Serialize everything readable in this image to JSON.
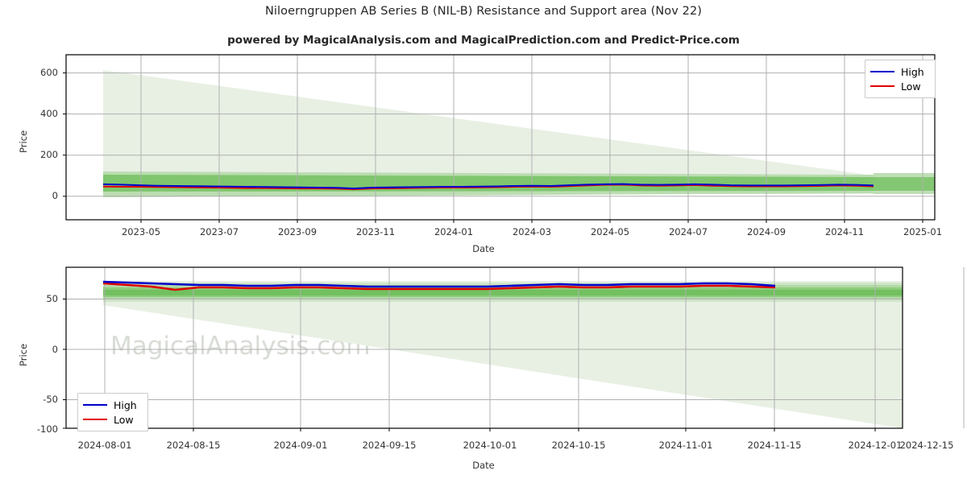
{
  "header": {
    "title": "Niloerngruppen AB Series B (NIL-B) Resistance and Support area (Nov 22)",
    "subtitle": "powered by MagicalAnalysis.com and MagicalPrediction.com and Predict-Price.com"
  },
  "watermarks": {
    "analysis": "MagicalAnalysis.com",
    "prediction": "MagicalPrediction.com"
  },
  "colors": {
    "high": "#0000cd",
    "low": "#e00000",
    "band_outer": "#e8f0e4",
    "band_mid": "#b8dbae",
    "band_inner": "#79c367",
    "grid": "#b0b0b0",
    "axis": "#000000",
    "watermark": "#d8dcd6"
  },
  "chart_data": [
    {
      "type": "line",
      "id": "overview",
      "title": "Niloerngruppen AB Series B (NIL-B) Resistance and Support area (Nov 22)",
      "xlabel": "Date",
      "ylabel": "Price",
      "grid": true,
      "legend_position": "upper right",
      "xlim": [
        "2023-03-20",
        "2025-01-10"
      ],
      "ylim": [
        -90,
        690
      ],
      "xticks": [
        "2023-05",
        "2023-07",
        "2023-09",
        "2023-11",
        "2024-01",
        "2024-03",
        "2024-05",
        "2024-07",
        "2024-09",
        "2024-11",
        "2025-01"
      ],
      "yticks": [
        0,
        200,
        400,
        600
      ],
      "legend": [
        {
          "name": "High",
          "color": "#0000cd"
        },
        {
          "name": "Low",
          "color": "#e00000"
        }
      ],
      "x": [
        "2023-04-10",
        "2023-04-24",
        "2023-05-08",
        "2023-05-22",
        "2023-06-05",
        "2023-06-19",
        "2023-07-03",
        "2023-07-17",
        "2023-07-31",
        "2023-08-14",
        "2023-08-28",
        "2023-09-11",
        "2023-09-25",
        "2023-10-09",
        "2023-10-23",
        "2023-11-06",
        "2023-11-20",
        "2023-12-04",
        "2023-12-18",
        "2024-01-01",
        "2024-01-15",
        "2024-01-29",
        "2024-02-12",
        "2024-02-26",
        "2024-03-11",
        "2024-03-25",
        "2024-04-08",
        "2024-04-22",
        "2024-05-06",
        "2024-05-20",
        "2024-06-03",
        "2024-06-17",
        "2024-07-01",
        "2024-07-15",
        "2024-07-29",
        "2024-08-12",
        "2024-08-26",
        "2024-09-09",
        "2024-09-23",
        "2024-10-07",
        "2024-10-21",
        "2024-11-04",
        "2024-11-18",
        "2024-12-02"
      ],
      "series": [
        {
          "name": "High",
          "color": "#0000cd",
          "values": [
            78,
            76,
            73,
            71,
            70,
            69,
            68,
            67,
            66,
            65,
            64,
            63,
            62,
            61,
            58,
            62,
            63,
            64,
            65,
            66,
            66,
            67,
            68,
            70,
            71,
            70,
            73,
            76,
            78,
            79,
            76,
            75,
            76,
            78,
            76,
            73,
            72,
            72,
            72,
            73,
            74,
            76,
            75,
            72
          ]
        },
        {
          "name": "Low",
          "color": "#e00000",
          "values": [
            67,
            66,
            66,
            65,
            64,
            63,
            62,
            61,
            60,
            60,
            59,
            58,
            58,
            57,
            54,
            58,
            59,
            60,
            61,
            62,
            62,
            63,
            64,
            66,
            67,
            66,
            69,
            72,
            75,
            76,
            72,
            71,
            72,
            74,
            71,
            69,
            68,
            68,
            68,
            69,
            70,
            72,
            71,
            68
          ]
        }
      ],
      "bands": [
        {
          "name": "outer",
          "color": "#e8f0e4",
          "y_start_top": 640,
          "y_end_top": 80,
          "y_start_bottom": 55,
          "y_end_bottom": 55
        },
        {
          "name": "mid",
          "color": "#b8dbae",
          "y_start_top": 95,
          "y_end_top": 82,
          "y_start_bottom": 50,
          "y_end_bottom": 58
        },
        {
          "name": "inner",
          "color": "#79c367",
          "y_start_top": 82,
          "y_end_top": 76,
          "y_start_bottom": 58,
          "y_end_bottom": 64
        }
      ]
    },
    {
      "type": "line",
      "id": "detail",
      "xlabel": "Date",
      "ylabel": "Price",
      "grid": true,
      "legend_position": "lower left",
      "xlim": [
        "2024-07-27",
        "2024-12-16"
      ],
      "ylim": [
        -108,
        92
      ],
      "xticks": [
        "2024-08-01",
        "2024-08-15",
        "2024-09-01",
        "2024-09-15",
        "2024-10-01",
        "2024-10-15",
        "2024-11-01",
        "2024-11-15",
        "2024-12-01",
        "2024-12-15"
      ],
      "yticks": [
        50,
        0,
        -50,
        -100
      ],
      "legend": [
        {
          "name": "High",
          "color": "#0000cd"
        },
        {
          "name": "Low",
          "color": "#e00000"
        }
      ],
      "x": [
        "2024-08-01",
        "2024-08-05",
        "2024-08-09",
        "2024-08-13",
        "2024-08-17",
        "2024-08-21",
        "2024-08-25",
        "2024-08-29",
        "2024-09-02",
        "2024-09-06",
        "2024-09-10",
        "2024-09-14",
        "2024-09-18",
        "2024-09-22",
        "2024-09-26",
        "2024-09-30",
        "2024-10-04",
        "2024-10-08",
        "2024-10-12",
        "2024-10-16",
        "2024-10-20",
        "2024-10-24",
        "2024-10-28",
        "2024-11-01",
        "2024-11-05",
        "2024-11-09",
        "2024-11-13",
        "2024-11-17",
        "2024-11-21"
      ],
      "series": [
        {
          "name": "High",
          "color": "#0000cd",
          "values": [
            74,
            73,
            72,
            71,
            70,
            70,
            69,
            69,
            70,
            70,
            69,
            68,
            68,
            68,
            68,
            68,
            68,
            69,
            70,
            71,
            70,
            70,
            71,
            71,
            71,
            72,
            72,
            71,
            69
          ]
        },
        {
          "name": "Low",
          "color": "#e00000",
          "values": [
            72,
            70,
            68,
            64,
            67,
            67,
            66,
            66,
            67,
            67,
            66,
            65,
            65,
            65,
            65,
            65,
            65,
            66,
            67,
            68,
            67,
            67,
            68,
            68,
            68,
            69,
            69,
            68,
            67
          ]
        }
      ],
      "bands": [
        {
          "name": "outer",
          "color": "#e8f0e4",
          "y_start_top": 80,
          "y_end_top": 80,
          "y_start_bottom": 55,
          "y_end_bottom": -100
        },
        {
          "name": "mid",
          "color": "#b8dbae",
          "y_start_top": 78,
          "y_end_top": 78,
          "y_start_bottom": 60,
          "y_end_bottom": 60
        },
        {
          "name": "inner",
          "color": "#79c367",
          "y_start_top": 73,
          "y_end_top": 73,
          "y_start_bottom": 64,
          "y_end_bottom": 64
        }
      ]
    }
  ]
}
